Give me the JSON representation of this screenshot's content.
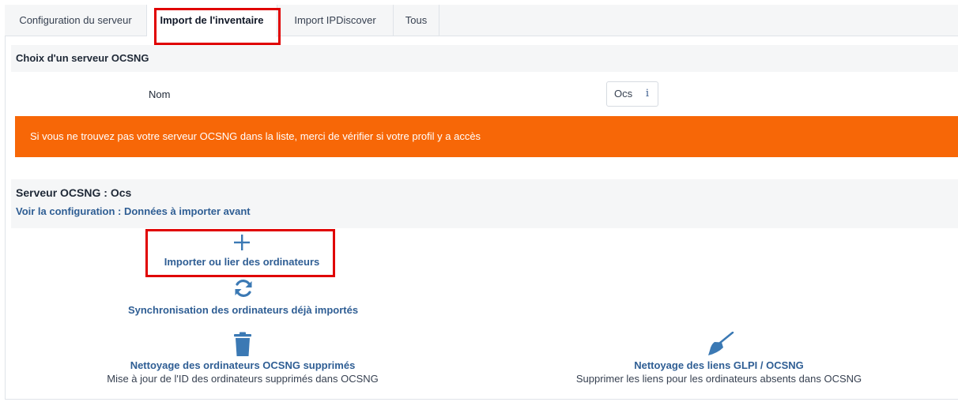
{
  "tabs": [
    {
      "label": "Configuration du serveur",
      "active": false
    },
    {
      "label": "Import de l'inventaire",
      "active": true
    },
    {
      "label": "Import IPDiscover",
      "active": false
    },
    {
      "label": "Tous",
      "active": false
    }
  ],
  "server_choice": {
    "heading": "Choix d'un serveur OCSNG",
    "field_label": "Nom",
    "select_value": "Ocs",
    "info_glyph": "i"
  },
  "alert": {
    "text": "Si vous ne trouvez pas votre serveur OCSNG dans la liste, merci de vérifier si votre profil y a accès",
    "color": "#f76707"
  },
  "server": {
    "title": "Serveur OCSNG : Ocs",
    "config_link": "Voir la configuration : Données à importer avant"
  },
  "actions": {
    "import": {
      "title": "Importer ou lier des ordinateurs",
      "icon": "plus-icon"
    },
    "sync": {
      "title": "Synchronisation des ordinateurs déjà importés",
      "icon": "sync-icon"
    },
    "clean_deleted": {
      "title": "Nettoyage des ordinateurs OCSNG supprimés",
      "subtitle": "Mise à jour de l'ID des ordinateurs supprimés dans OCSNG",
      "icon": "trash-icon"
    },
    "clean_links": {
      "title": "Nettoyage des liens GLPI / OCSNG",
      "subtitle": "Supprimer les liens pour les ordinateurs absents dans OCSNG",
      "icon": "broom-icon"
    }
  },
  "colors": {
    "link": "#2f5e94",
    "icon": "#3b79b4",
    "highlight": "#e00000"
  }
}
